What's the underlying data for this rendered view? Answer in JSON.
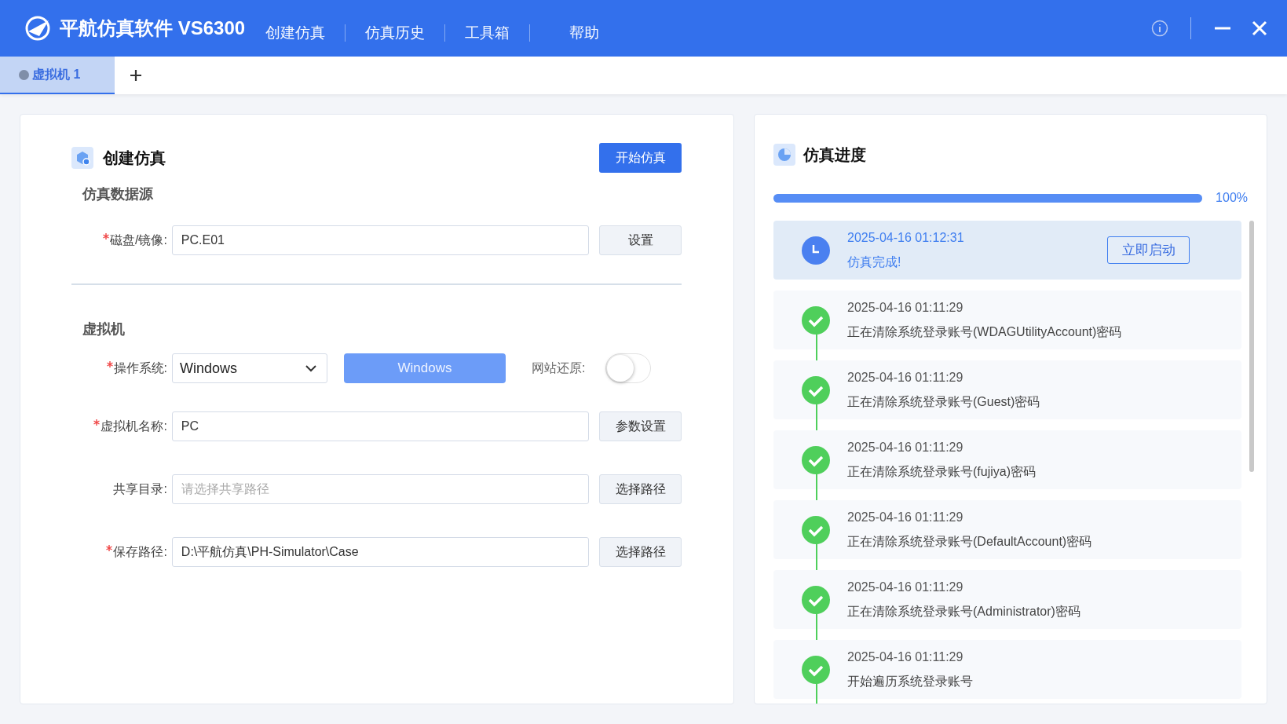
{
  "app": {
    "title": "平航仿真软件 VS6300"
  },
  "menu": [
    {
      "label": "创建仿真"
    },
    {
      "label": "仿真历史"
    },
    {
      "label": "工具箱"
    },
    {
      "label": "帮助"
    }
  ],
  "tabs": [
    {
      "label": "虚拟机 1",
      "selected": true
    }
  ],
  "create_panel": {
    "title": "创建仿真",
    "start_button": "开始仿真",
    "source_section": "仿真数据源",
    "disk": {
      "label": "磁盘/镜像:",
      "required": true,
      "value": "PC.E01",
      "button": "设置"
    },
    "vm_section": "虚拟机",
    "os": {
      "label": "操作系统:",
      "required": true,
      "value": "Windows",
      "os_button": "Windows",
      "restore_label": "网站还原:",
      "restore_on": false
    },
    "fields": [
      {
        "label": "虚拟机名称:",
        "required": true,
        "value": "PC",
        "button": "参数设置"
      },
      {
        "label": "共享目录:",
        "required": false,
        "placeholder": "请选择共享路径",
        "button": "选择路径"
      },
      {
        "label": "保存路径:",
        "required": true,
        "value": "D:\\平航仿真\\PH-Simulator\\Case",
        "button": "选择路径"
      }
    ]
  },
  "progress_panel": {
    "title": "仿真进度",
    "level": 1.0,
    "reading": "100%",
    "log": [
      {
        "kind": "complete",
        "time": "2025-04-16 01:12:31",
        "message": "仿真完成!",
        "button": "立即启动"
      },
      {
        "kind": "done",
        "time": "2025-04-16 01:11:29",
        "message": "正在清除系统登录账号(WDAGUtilityAccount)密码"
      },
      {
        "kind": "done",
        "time": "2025-04-16 01:11:29",
        "message": "正在清除系统登录账号(Guest)密码"
      },
      {
        "kind": "done",
        "time": "2025-04-16 01:11:29",
        "message": "正在清除系统登录账号(fujiya)密码"
      },
      {
        "kind": "done",
        "time": "2025-04-16 01:11:29",
        "message": "正在清除系统登录账号(DefaultAccount)密码"
      },
      {
        "kind": "done",
        "time": "2025-04-16 01:11:29",
        "message": "正在清除系统登录账号(Administrator)密码"
      },
      {
        "kind": "done",
        "time": "2025-04-16 01:11:29",
        "message": "开始遍历系统登录账号"
      }
    ]
  }
}
